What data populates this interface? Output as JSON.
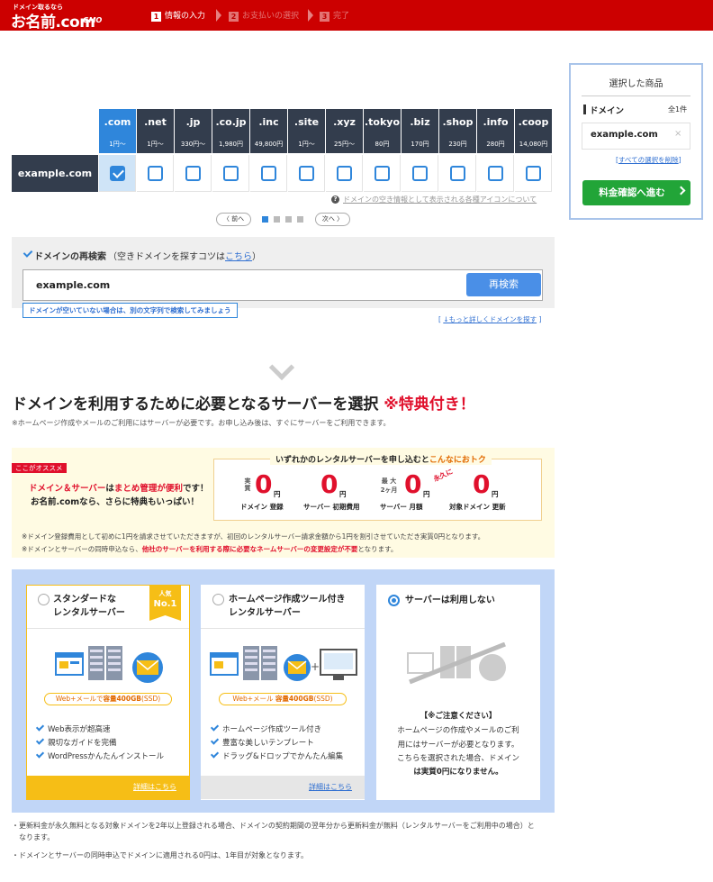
{
  "header": {
    "logo_small": "ドメイン取るなら",
    "logo_main": "お名前.com",
    "logo_gmo": "GMO",
    "steps": [
      {
        "num": "1",
        "label": "情報の入力"
      },
      {
        "num": "2",
        "label": "お支払いの選択"
      },
      {
        "num": "3",
        "label": "完了"
      }
    ]
  },
  "tld_table": {
    "domain": "example.com",
    "tlds": [
      {
        "name": ".com",
        "price": "1円〜",
        "checked": true
      },
      {
        "name": ".net",
        "price": "1円〜",
        "checked": false
      },
      {
        "name": ".jp",
        "price": "330円〜",
        "checked": false
      },
      {
        "name": ".co.jp",
        "price": "1,980円",
        "checked": false
      },
      {
        "name": ".inc",
        "price": "49,800円",
        "checked": false
      },
      {
        "name": ".site",
        "price": "1円〜",
        "checked": false
      },
      {
        "name": ".xyz",
        "price": "25円〜",
        "checked": false
      },
      {
        "name": ".tokyo",
        "price": "80円",
        "checked": false
      },
      {
        "name": ".biz",
        "price": "170円",
        "checked": false
      },
      {
        "name": ".shop",
        "price": "230円",
        "checked": false
      },
      {
        "name": ".info",
        "price": "280円",
        "checked": false
      },
      {
        "name": ".coop",
        "price": "14,080円",
        "checked": false
      }
    ],
    "icon_help_text": "ドメインの空き情報として表示される各種アイコンについて",
    "prev_label": "〈 前へ",
    "next_label": "次へ 〉"
  },
  "research": {
    "title": "ドメインの再検索",
    "sub_prefix": "（空きドメインを探すコツは",
    "sub_link": "こちら",
    "sub_suffix": "）",
    "value": "example.com",
    "button": "再検索",
    "tip": "ドメインが空いていない場合は、別の文字列で検索してみましょう",
    "more_link": "↓もっと詳しくドメインを探す"
  },
  "side_panel": {
    "title": "選択した商品",
    "domain_label": "ドメイン",
    "count": "全1件",
    "item": "example.com",
    "remove_icon": "×",
    "clear_all": "すべての選択を削除",
    "confirm_button": "料金確認へ進む"
  },
  "server_section": {
    "heading": "ドメインを利用するために必要となるサーバーを選択",
    "bonus": "※特典付き！",
    "note": "※ホームページ作成やメールのご利用にはサーバーが必要です。お申し込み後は、すぐにサーバーをご利用できます。"
  },
  "promo": {
    "tag": "ここがオススメ",
    "left_line1_red": "ドメイン＆サーバー",
    "left_line1_mid": "は",
    "left_line1_red2": "まとめ管理が便利",
    "left_line1_end": "です！",
    "left_line2": "お名前.comなら、さらに特典もいっぱい！",
    "box_head_prefix": "いずれかのレンタルサーバーを申し込むと",
    "box_head_orange": "こんなにおトク",
    "items": [
      {
        "pre1": "実質",
        "pre2": "",
        "value": "0",
        "unit": "円",
        "caption": "ドメイン 登録"
      },
      {
        "pre1": "",
        "pre2": "",
        "value": "0",
        "unit": "円",
        "caption": "サーバー 初期費用"
      },
      {
        "pre1": "最 大",
        "pre2": "2ヶ月",
        "value": "0",
        "unit": "円",
        "caption": "サーバー 月額"
      },
      {
        "pre1": "",
        "pre2": "",
        "value": "0",
        "unit": "円",
        "caption": "対象ドメイン 更新"
      }
    ],
    "forever": "永久に",
    "note1": "※ドメイン登録費用として初めに1円を請求させていただきますが、初回のレンタルサーバー請求金額から1円を割引させていただき実質0円となります。",
    "note2_prefix": "※ドメインとサーバーの同時申込なら、",
    "note2_red": "他社のサーバーを利用する際に必要なネームサーバーの変更設定が不要",
    "note2_suffix": "となります。"
  },
  "plans": [
    {
      "title_line1": "スタンダードな",
      "title_line2": "レンタルサーバー",
      "badge_line1": "人気",
      "badge_line2": "No.1",
      "capacity_prefix": "Web+メールで",
      "capacity_bold": "容量400GB",
      "capacity_suffix": "(SSD)",
      "features": [
        "Web表示が超高速",
        "親切なガイドを完備",
        "WordPressかんたんインストール"
      ],
      "detail_link": "詳細はこちら",
      "selected": false
    },
    {
      "title_line1": "ホームページ作成ツール付き",
      "title_line2": "レンタルサーバー",
      "capacity_prefix": "Web+メール ",
      "capacity_bold": "容量400GB",
      "capacity_suffix": "(SSD)",
      "features": [
        "ホームページ作成ツール付き",
        "豊富な美しいテンプレート",
        "ドラッグ&ドロップでかんたん編集"
      ],
      "detail_link": "詳細はこちら",
      "selected": false
    },
    {
      "title_line1": "サーバーは利用しない",
      "caution": "【※ご注意ください】",
      "body_line1": "ホームページの作成やメールのご利",
      "body_line2": "用にはサーバーが必要となります。",
      "body_line3": "こちらを選択された場合、ドメイン",
      "body_line4": "は実質0円になりません。",
      "selected": true
    }
  ],
  "footnotes": [
    "・更新料金が永久無料となる対象ドメインを2年以上登録される場合、ドメインの契約期間の翌年分から更新料金が無料（レンタルサーバーをご利用中の場合）と",
    "　なります。",
    "・ドメインとサーバーの同時申込でドメインに適用される0円は、1年目が対象となります。"
  ],
  "colors": {
    "brand_red": "#cc0000",
    "accent_blue": "#2f86db",
    "table_dark": "#333d4d",
    "confirm_green": "#22a538",
    "promo_red": "#e0102c",
    "popular_yellow": "#f6be16"
  }
}
